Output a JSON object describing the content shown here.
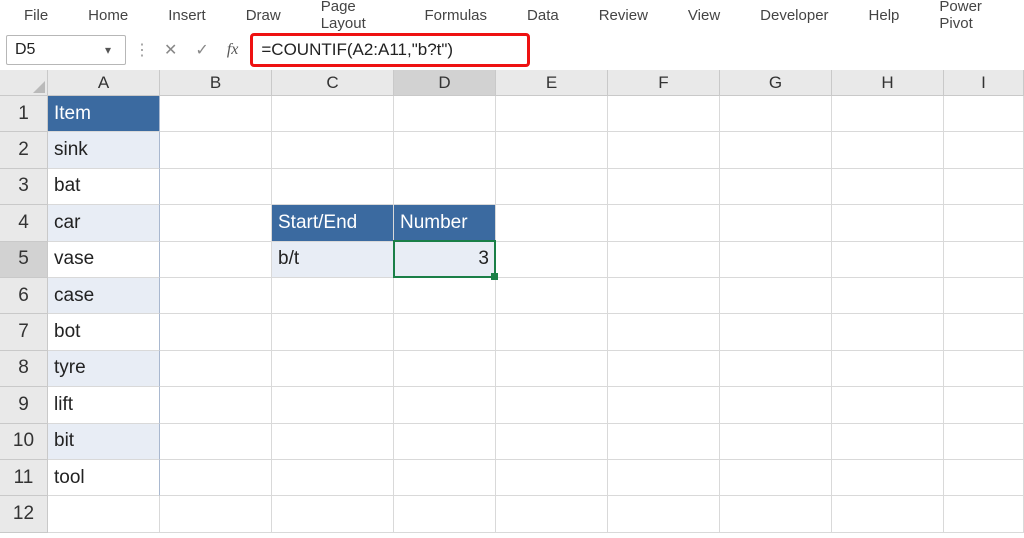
{
  "ribbon": {
    "tabs": [
      "File",
      "Home",
      "Insert",
      "Draw",
      "Page Layout",
      "Formulas",
      "Data",
      "Review",
      "View",
      "Developer",
      "Help",
      "Power Pivot"
    ]
  },
  "namebox": {
    "value": "D5"
  },
  "formula_bar": {
    "cancel_glyph": "✕",
    "enter_glyph": "✓",
    "fx_label": "fx",
    "formula": "=COUNTIF(A2:A11,\"b?t\")"
  },
  "columns": [
    "A",
    "B",
    "C",
    "D",
    "E",
    "F",
    "G",
    "H",
    "I"
  ],
  "active_col": "D",
  "active_row": 5,
  "row_headers": [
    "1",
    "2",
    "3",
    "4",
    "5",
    "6",
    "7",
    "8",
    "9",
    "10",
    "11",
    "12"
  ],
  "cells": {
    "A1": "Item",
    "A2": "sink",
    "A3": "bat",
    "A4": "car",
    "A5": "vase",
    "A6": "case",
    "A7": "bot",
    "A8": "tyre",
    "A9": "lift",
    "A10": "bit",
    "A11": "tool",
    "C4": "Start/End",
    "D4": "Number",
    "C5": "b/t",
    "D5": "3"
  },
  "chart_data": {
    "type": "table",
    "title": "COUNTIF with single-character wildcard",
    "items_range": "A2:A11",
    "items": [
      "sink",
      "bat",
      "car",
      "vase",
      "case",
      "bot",
      "tyre",
      "lift",
      "bit",
      "tool"
    ],
    "criteria_label": "Start/End",
    "criteria_value": "b/t",
    "count_label": "Number",
    "formula": "=COUNTIF(A2:A11,\"b?t\")",
    "result": 3
  }
}
